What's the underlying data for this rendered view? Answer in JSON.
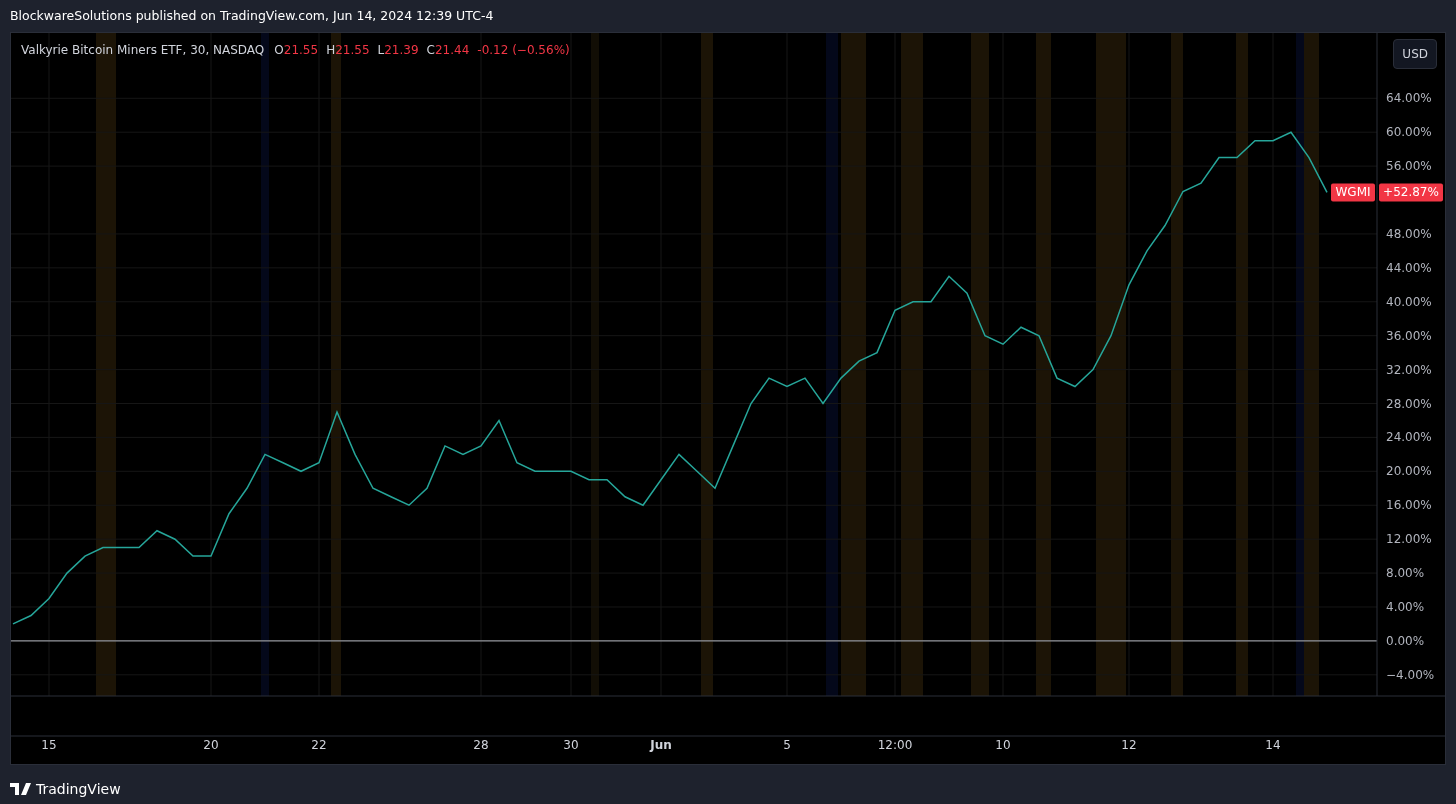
{
  "header": {
    "title": "BlockwareSolutions published on TradingView.com, Jun 14, 2024 12:39 UTC-4"
  },
  "legend": {
    "symbol": "Valkyrie Bitcoin Miners ETF, 30, NASDAQ",
    "ohlc": [
      {
        "label": "O",
        "value": "21.55"
      },
      {
        "label": "H",
        "value": "21.55"
      },
      {
        "label": "L",
        "value": "21.39"
      },
      {
        "label": "C",
        "value": "21.44"
      }
    ],
    "change": "-0.12 (−0.56%)"
  },
  "currency_button": {
    "label": "USD"
  },
  "price_label": {
    "value": "+52.87%"
  },
  "chart": {
    "chart_data": {
      "type": "line",
      "categories": [
        null,
        null,
        "15",
        null,
        null,
        null,
        null,
        null,
        null,
        null,
        null,
        "20",
        null,
        null,
        null,
        null,
        null,
        "22",
        null,
        null,
        null,
        null,
        null,
        null,
        null,
        null,
        "28",
        null,
        null,
        null,
        null,
        "30",
        null,
        null,
        null,
        null,
        "Jun",
        null,
        null,
        null,
        null,
        null,
        null,
        "5",
        null,
        null,
        null,
        null,
        null,
        "12:00",
        null,
        null,
        null,
        null,
        null,
        "10",
        null,
        null,
        null,
        null,
        null,
        null,
        "12",
        null,
        null,
        null,
        null,
        null,
        null,
        null,
        "14",
        null,
        null,
        null
      ],
      "series": [
        {
          "name": "WGMI",
          "color": "#26a69a",
          "values": [
            2,
            3,
            5,
            8,
            10,
            11,
            11,
            11,
            13,
            12,
            10,
            10,
            15,
            18,
            22,
            21,
            20,
            21,
            27,
            22,
            18,
            17,
            16,
            18,
            23,
            22,
            23,
            26,
            21,
            20,
            20,
            20,
            19,
            19,
            17,
            16,
            19,
            22,
            20,
            18,
            23,
            28,
            31,
            30,
            31,
            28,
            31,
            33,
            34,
            39,
            40,
            40,
            43,
            41,
            36,
            35,
            37,
            36,
            31,
            30,
            32,
            36,
            42,
            46,
            49,
            53,
            54,
            57,
            57,
            59,
            59,
            60,
            57,
            52.9
          ]
        }
      ],
      "ylim": [
        -6.5,
        71.7
      ],
      "grid": true,
      "yticks": [
        {
          "value": -4,
          "label": "−4.00%"
        },
        {
          "value": 0,
          "label": "0.00%"
        },
        {
          "value": 4,
          "label": "4.00%"
        },
        {
          "value": 8,
          "label": "8.00%"
        },
        {
          "value": 12,
          "label": "12.00%"
        },
        {
          "value": 16,
          "label": "16.00%"
        },
        {
          "value": 20,
          "label": "20.00%"
        },
        {
          "value": 24,
          "label": "24.00%"
        },
        {
          "value": 28,
          "label": "28.00%"
        },
        {
          "value": 32,
          "label": "32.00%"
        },
        {
          "value": 36,
          "label": "36.00%"
        },
        {
          "value": 40,
          "label": "40.00%"
        },
        {
          "value": 44,
          "label": "44.00%"
        },
        {
          "value": 48,
          "label": "48.00%"
        },
        {
          "value": 56,
          "label": "56.00%"
        },
        {
          "value": 60,
          "label": "60.00%"
        },
        {
          "value": 64,
          "label": "64.00%"
        }
      ]
    }
  },
  "footer": {
    "brand": "TradingView"
  }
}
